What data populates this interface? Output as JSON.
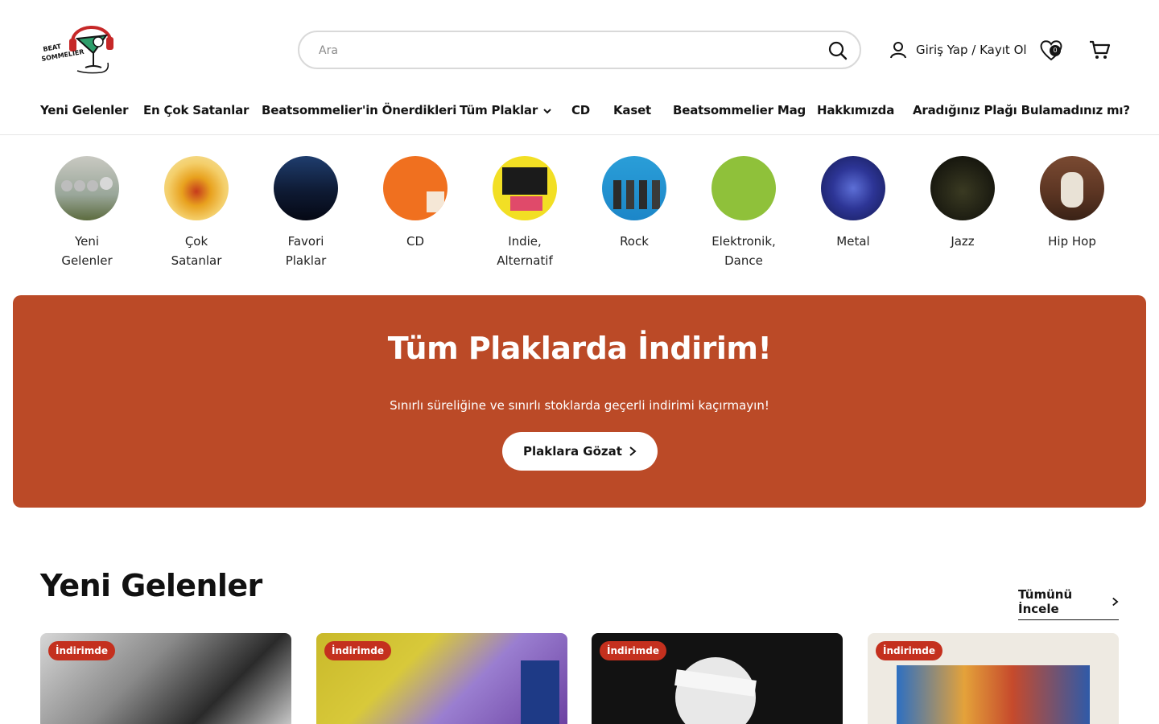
{
  "brand": {
    "logo_text_1": "BEAT",
    "logo_text_2": "SOMMELIER"
  },
  "search": {
    "placeholder": "Ara"
  },
  "account": {
    "login_label": "Giriş Yap / Kayıt Ol"
  },
  "wishlist": {
    "count": "0"
  },
  "nav": {
    "items": [
      "Yeni Gelenler",
      "En Çok Satanlar",
      "Beatsommelier'in Önerdikleri",
      "Tüm Plaklar",
      "CD",
      "Kaset",
      "Beatsommelier Mag",
      "Hakkımızda",
      "Aradığınız Plağı Bulamadınız mı?"
    ]
  },
  "categories": [
    {
      "line1": "Yeni",
      "line2": "Gelenler"
    },
    {
      "line1": "Çok",
      "line2": "Satanlar"
    },
    {
      "line1": "Favori",
      "line2": "Plaklar"
    },
    {
      "line1": "CD",
      "line2": ""
    },
    {
      "line1": "Indie,",
      "line2": "Alternatif"
    },
    {
      "line1": "Rock",
      "line2": ""
    },
    {
      "line1": "Elektronik,",
      "line2": "Dance"
    },
    {
      "line1": "Metal",
      "line2": ""
    },
    {
      "line1": "Jazz",
      "line2": ""
    },
    {
      "line1": "Hip Hop",
      "line2": ""
    }
  ],
  "banner": {
    "title": "Tüm Plaklarda İndirim!",
    "subtitle": "Sınırlı süreliğine ve sınırlı stoklarda geçerli indirimi kaçırmayın!",
    "button_label": "Plaklara Gözat",
    "color": "#bb4a27"
  },
  "new_arrivals": {
    "title": "Yeni Gelenler",
    "see_all_label": "Tümünü İncele",
    "products": [
      {
        "badge": "İndirimde"
      },
      {
        "badge": "İndirimde"
      },
      {
        "badge": "İndirimde"
      },
      {
        "badge": "İndirimde"
      }
    ]
  }
}
